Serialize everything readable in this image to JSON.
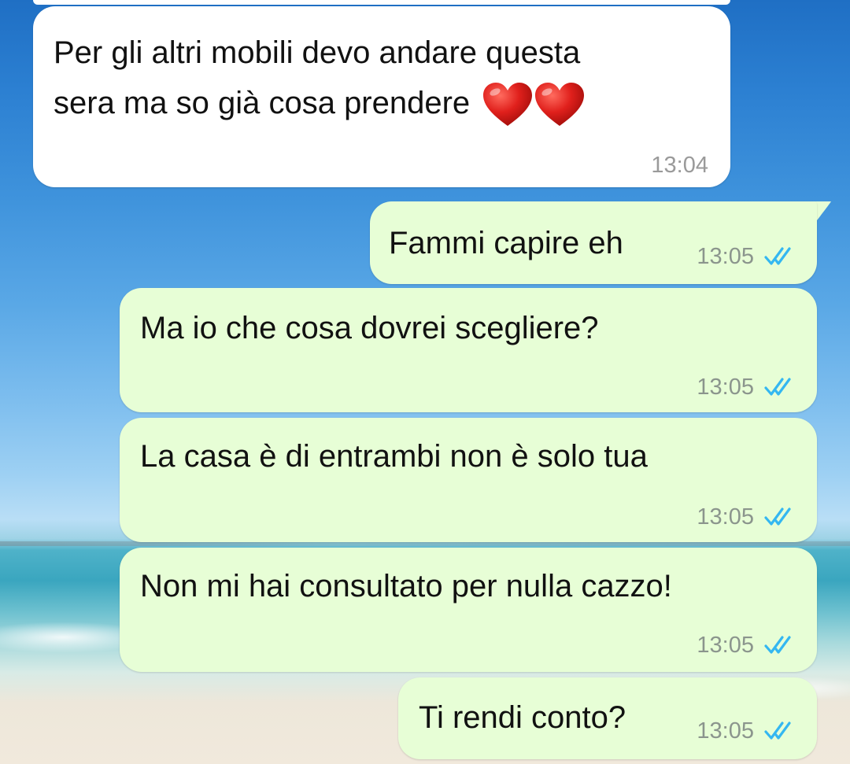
{
  "wallpaper": "beach-sky-sea",
  "colors": {
    "incoming_bubble": "#ffffff",
    "outgoing_bubble": "#e7fed6",
    "read_ticks": "#34b7f1",
    "heart": "#e0201c"
  },
  "messages": [
    {
      "direction": "incoming",
      "lines": [
        "Per gli altri mobili devo andare questa",
        "sera ma so già cosa prendere"
      ],
      "emoji": [
        "heart-icon",
        "heart-icon"
      ],
      "time": "13:04"
    },
    {
      "direction": "outgoing",
      "text": "Fammi capire eh",
      "time": "13:05",
      "status": "read-double-tick-icon"
    },
    {
      "direction": "outgoing",
      "text": "Ma io che cosa dovrei scegliere?",
      "time": "13:05",
      "status": "read-double-tick-icon"
    },
    {
      "direction": "outgoing",
      "text": "La casa è di entrambi non è solo tua",
      "time": "13:05",
      "status": "read-double-tick-icon"
    },
    {
      "direction": "outgoing",
      "text": "Non mi hai consultato per nulla cazzo!",
      "time": "13:05",
      "status": "read-double-tick-icon"
    },
    {
      "direction": "outgoing",
      "text": "Ti rendi conto?",
      "time": "13:05",
      "status": "read-double-tick-icon"
    }
  ]
}
